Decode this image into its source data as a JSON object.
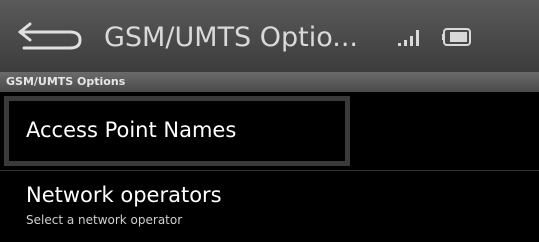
{
  "title_bar": {
    "title": "GSM/UMTS Optio...",
    "back_icon": "back-arrow-icon",
    "status_icons": [
      "signal-icon",
      "battery-icon"
    ]
  },
  "section_header": "GSM/UMTS Options",
  "items": [
    {
      "title": "Access Point Names",
      "focused": true
    },
    {
      "title": "Network operators",
      "summary": "Select a network operator"
    }
  ],
  "colors": {
    "titlebar_bg": "#4a4a4a",
    "list_bg": "#000000",
    "text_primary": "#ffffff",
    "text_secondary": "#cfcfcf"
  }
}
